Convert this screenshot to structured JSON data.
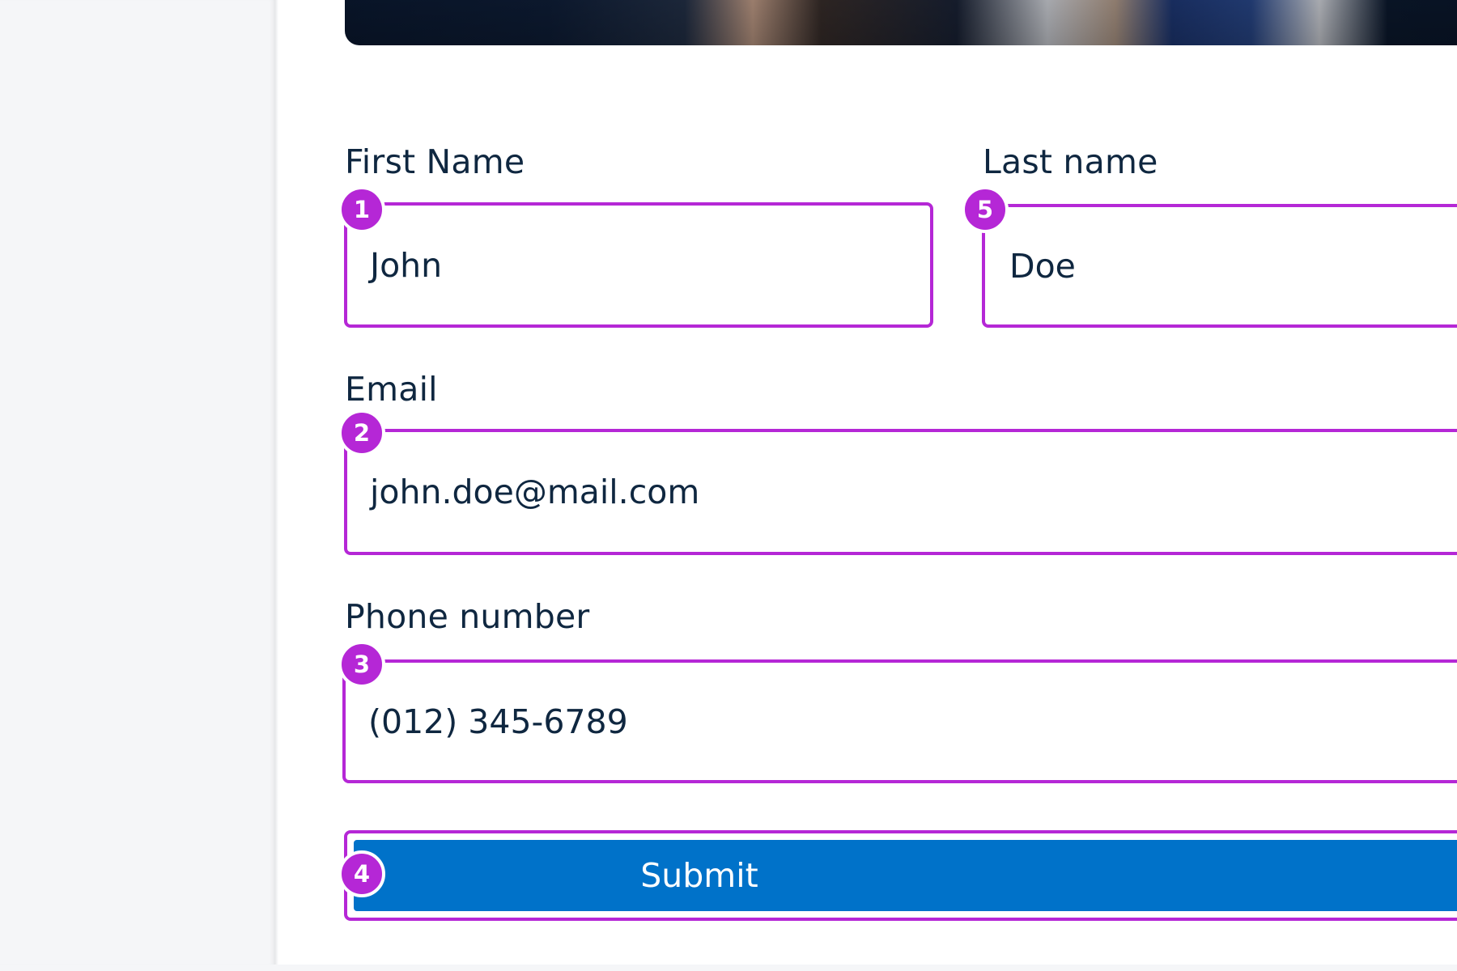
{
  "form": {
    "first_name": {
      "label": "First Name",
      "value": "John",
      "badge": "1"
    },
    "last_name": {
      "label": "Last name",
      "value": "Doe",
      "badge": "5"
    },
    "email": {
      "label": "Email",
      "value": "john.doe@mail.com",
      "badge": "2"
    },
    "phone": {
      "label": "Phone number",
      "value": "(012) 345-6789",
      "badge": "3"
    },
    "submit": {
      "label": "Submit",
      "badge": "4"
    }
  },
  "colors": {
    "annotation": "#b527d6",
    "primary_button": "#0072c9",
    "text": "#0f2740",
    "side_panel": "#f5f6f8"
  }
}
